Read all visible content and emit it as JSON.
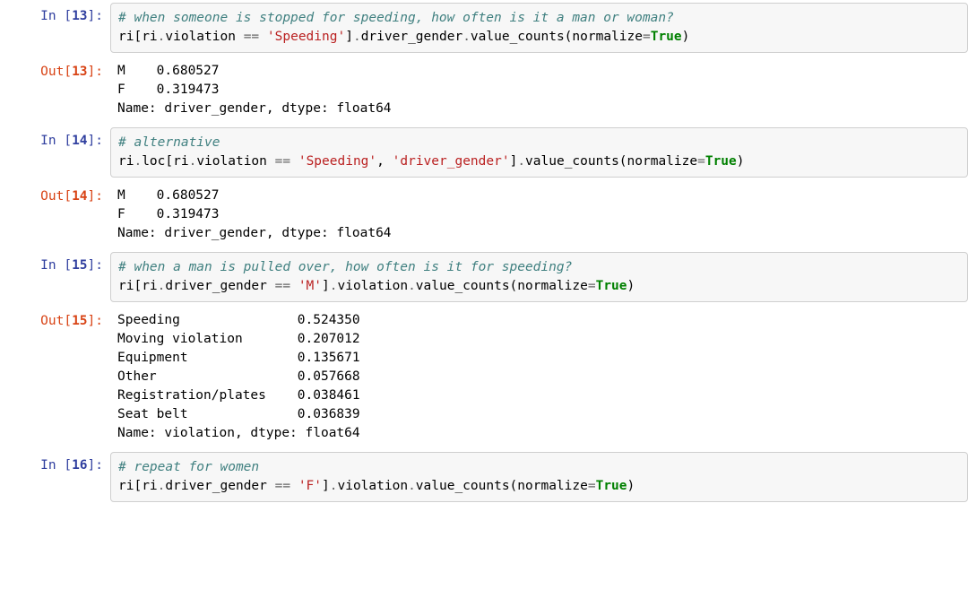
{
  "cells": [
    {
      "id": "13",
      "type": "in",
      "code": [
        {
          "tokens": [
            {
              "t": "# when someone is stopped for speeding, how often is it a man or woman?",
              "c": "c-comment"
            }
          ]
        },
        {
          "tokens": [
            {
              "t": "ri[ri",
              "c": ""
            },
            {
              "t": ".",
              "c": "c-op"
            },
            {
              "t": "violation ",
              "c": ""
            },
            {
              "t": "==",
              "c": "c-op"
            },
            {
              "t": " ",
              "c": ""
            },
            {
              "t": "'Speeding'",
              "c": "c-string"
            },
            {
              "t": "]",
              "c": ""
            },
            {
              "t": ".",
              "c": "c-op"
            },
            {
              "t": "driver_gender",
              "c": ""
            },
            {
              "t": ".",
              "c": "c-op"
            },
            {
              "t": "value_counts(normalize",
              "c": ""
            },
            {
              "t": "=",
              "c": "c-op"
            },
            {
              "t": "True",
              "c": "c-keyword"
            },
            {
              "t": ")",
              "c": ""
            }
          ]
        }
      ]
    },
    {
      "id": "13",
      "type": "out",
      "text": "M    0.680527\nF    0.319473\nName: driver_gender, dtype: float64"
    },
    {
      "id": "14",
      "type": "in",
      "code": [
        {
          "tokens": [
            {
              "t": "# alternative",
              "c": "c-comment"
            }
          ]
        },
        {
          "tokens": [
            {
              "t": "ri",
              "c": ""
            },
            {
              "t": ".",
              "c": "c-op"
            },
            {
              "t": "loc[ri",
              "c": ""
            },
            {
              "t": ".",
              "c": "c-op"
            },
            {
              "t": "violation ",
              "c": ""
            },
            {
              "t": "==",
              "c": "c-op"
            },
            {
              "t": " ",
              "c": ""
            },
            {
              "t": "'Speeding'",
              "c": "c-string"
            },
            {
              "t": ", ",
              "c": ""
            },
            {
              "t": "'driver_gender'",
              "c": "c-string"
            },
            {
              "t": "]",
              "c": ""
            },
            {
              "t": ".",
              "c": "c-op"
            },
            {
              "t": "value_counts(normalize",
              "c": ""
            },
            {
              "t": "=",
              "c": "c-op"
            },
            {
              "t": "True",
              "c": "c-keyword"
            },
            {
              "t": ")",
              "c": ""
            }
          ]
        }
      ]
    },
    {
      "id": "14",
      "type": "out",
      "text": "M    0.680527\nF    0.319473\nName: driver_gender, dtype: float64"
    },
    {
      "id": "15",
      "type": "in",
      "code": [
        {
          "tokens": [
            {
              "t": "# when a man is pulled over, how often is it for speeding?",
              "c": "c-comment"
            }
          ]
        },
        {
          "tokens": [
            {
              "t": "ri[ri",
              "c": ""
            },
            {
              "t": ".",
              "c": "c-op"
            },
            {
              "t": "driver_gender ",
              "c": ""
            },
            {
              "t": "==",
              "c": "c-op"
            },
            {
              "t": " ",
              "c": ""
            },
            {
              "t": "'M'",
              "c": "c-string"
            },
            {
              "t": "]",
              "c": ""
            },
            {
              "t": ".",
              "c": "c-op"
            },
            {
              "t": "violation",
              "c": ""
            },
            {
              "t": ".",
              "c": "c-op"
            },
            {
              "t": "value_counts(normalize",
              "c": ""
            },
            {
              "t": "=",
              "c": "c-op"
            },
            {
              "t": "True",
              "c": "c-keyword"
            },
            {
              "t": ")",
              "c": ""
            }
          ]
        }
      ]
    },
    {
      "id": "15",
      "type": "out",
      "text": "Speeding               0.524350\nMoving violation       0.207012\nEquipment              0.135671\nOther                  0.057668\nRegistration/plates    0.038461\nSeat belt              0.036839\nName: violation, dtype: float64"
    },
    {
      "id": "16",
      "type": "in",
      "code": [
        {
          "tokens": [
            {
              "t": "# repeat for women",
              "c": "c-comment"
            }
          ]
        },
        {
          "tokens": [
            {
              "t": "ri[ri",
              "c": ""
            },
            {
              "t": ".",
              "c": "c-op"
            },
            {
              "t": "driver_gender ",
              "c": ""
            },
            {
              "t": "==",
              "c": "c-op"
            },
            {
              "t": " ",
              "c": ""
            },
            {
              "t": "'F'",
              "c": "c-string"
            },
            {
              "t": "]",
              "c": ""
            },
            {
              "t": ".",
              "c": "c-op"
            },
            {
              "t": "violation",
              "c": ""
            },
            {
              "t": ".",
              "c": "c-op"
            },
            {
              "t": "value_counts(normalize",
              "c": ""
            },
            {
              "t": "=",
              "c": "c-op"
            },
            {
              "t": "True",
              "c": "c-keyword"
            },
            {
              "t": ")",
              "c": ""
            }
          ]
        }
      ]
    }
  ],
  "prompts": {
    "in_prefix": "In [",
    "out_prefix": "Out[",
    "suffix": "]:"
  }
}
